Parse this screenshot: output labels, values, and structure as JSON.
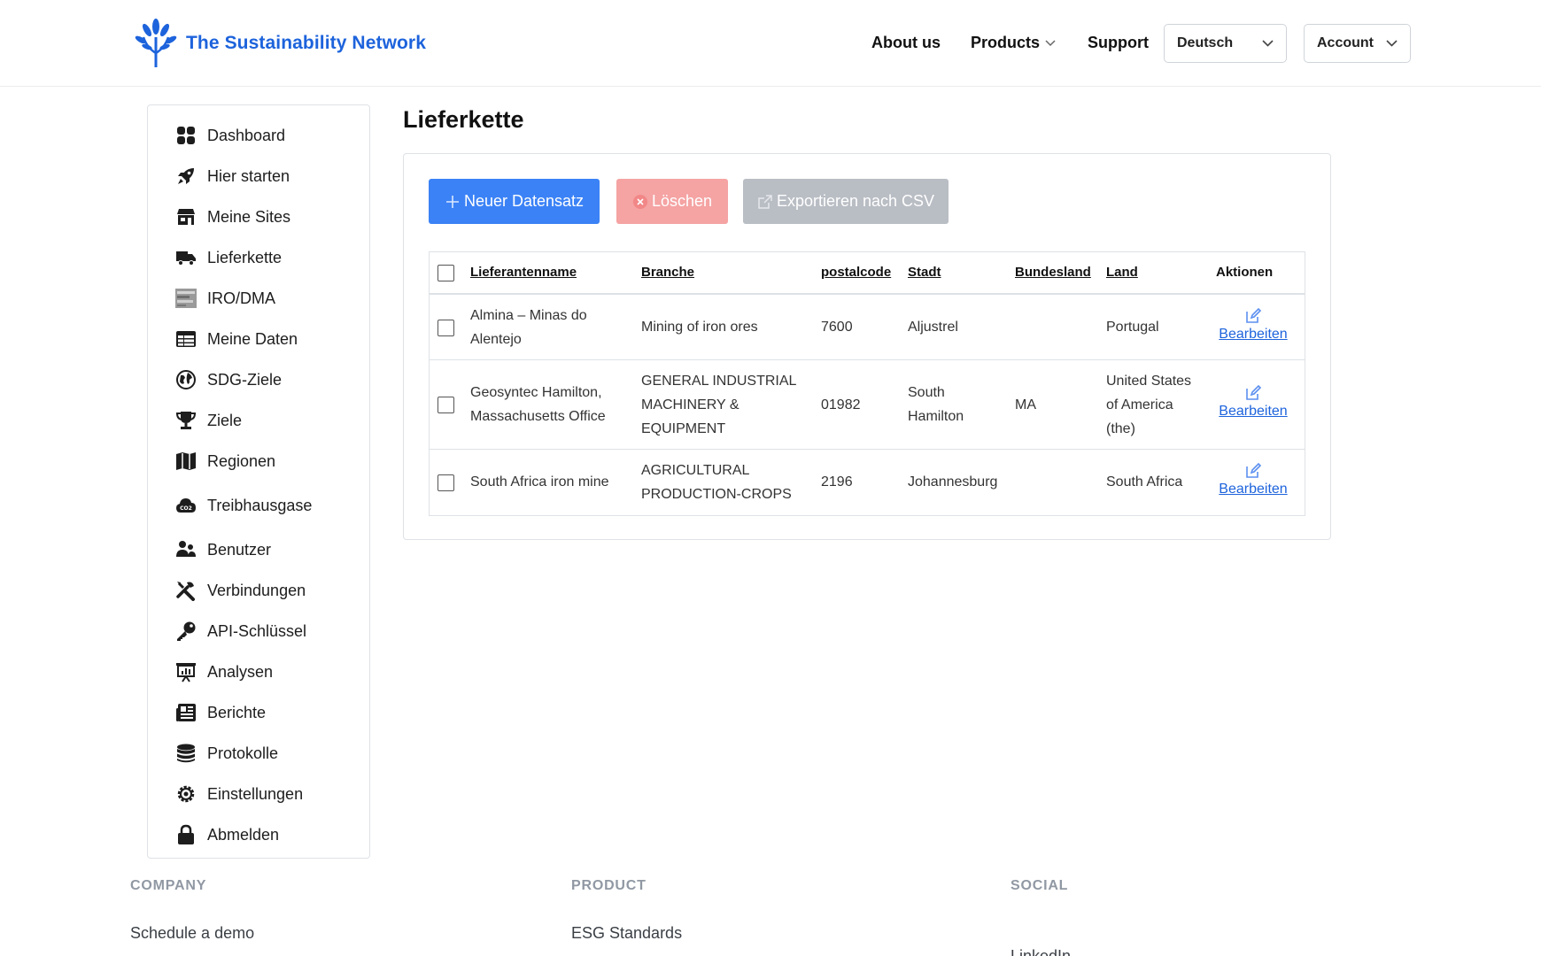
{
  "brand": {
    "name": "The Sustainability Network",
    "color": "#1d63dc"
  },
  "nav": {
    "about": "About us",
    "products": "Products",
    "support": "Support",
    "language": "Deutsch",
    "account": "Account"
  },
  "sidebar": {
    "items": [
      {
        "label": "Dashboard",
        "icon": "dashboard-icon"
      },
      {
        "label": "Hier starten",
        "icon": "rocket-icon"
      },
      {
        "label": "Meine Sites",
        "icon": "store-icon"
      },
      {
        "label": "Lieferkette",
        "icon": "truck-icon"
      },
      {
        "label": "IRO/DMA",
        "icon": "iro-dma-image-icon"
      },
      {
        "label": "Meine Daten",
        "icon": "table-icon"
      },
      {
        "label": "SDG-Ziele",
        "icon": "globe-icon"
      },
      {
        "label": "Ziele",
        "icon": "trophy-icon"
      },
      {
        "label": "Regionen",
        "icon": "map-icon"
      },
      {
        "label": "Treibhausgase",
        "icon": "co2-cloud-icon"
      },
      {
        "label": "Benutzer",
        "icon": "users-icon"
      },
      {
        "label": "Verbindungen",
        "icon": "tools-icon"
      },
      {
        "label": "API-Schlüssel",
        "icon": "key-icon"
      },
      {
        "label": "Analysen",
        "icon": "presentation-chart-icon"
      },
      {
        "label": "Berichte",
        "icon": "newspaper-icon"
      },
      {
        "label": "Protokolle",
        "icon": "database-icon"
      },
      {
        "label": "Einstellungen",
        "icon": "gear-icon"
      },
      {
        "label": "Abmelden",
        "icon": "lock-icon"
      }
    ]
  },
  "main": {
    "title": "Lieferkette",
    "buttons": {
      "new": "Neuer Datensatz",
      "delete": "Löschen",
      "export": "Exportieren nach CSV"
    },
    "table": {
      "headers": {
        "name": "Lieferantenname",
        "branch": "Branche",
        "postalcode": "postalcode",
        "city": "Stadt",
        "state": "Bundesland",
        "country": "Land",
        "actions": "Aktionen"
      },
      "edit_label": "Bearbeiten",
      "rows": [
        {
          "name_1": "Almina – Minas do",
          "name_2": "Alentejo",
          "branch_1": "Mining of iron ores",
          "postalcode": "7600",
          "city_1": "Aljustrel",
          "state": "",
          "country_1": "Portugal"
        },
        {
          "name_1": "Geosyntec Hamilton,",
          "name_2": "Massachusetts Office",
          "branch_1": "GENERAL INDUSTRIAL",
          "branch_2": "MACHINERY &",
          "branch_3": "EQUIPMENT",
          "postalcode": "01982",
          "city_1": "South",
          "city_2": "Hamilton",
          "state": "MA",
          "country_1": "United States",
          "country_2": "of America",
          "country_3": "(the)"
        },
        {
          "name_1": "South Africa iron mine",
          "branch_1": "AGRICULTURAL",
          "branch_2": "PRODUCTION-CROPS",
          "postalcode": "2196",
          "city_1": "Johannesburg",
          "state": "",
          "country_1": "South Africa"
        }
      ]
    }
  },
  "footer": {
    "company": "COMPANY",
    "product": "PRODUCT",
    "social": "SOCIAL",
    "company_link": "Schedule a demo",
    "product_link": "ESG Standards",
    "social_link": "LinkedIn"
  }
}
